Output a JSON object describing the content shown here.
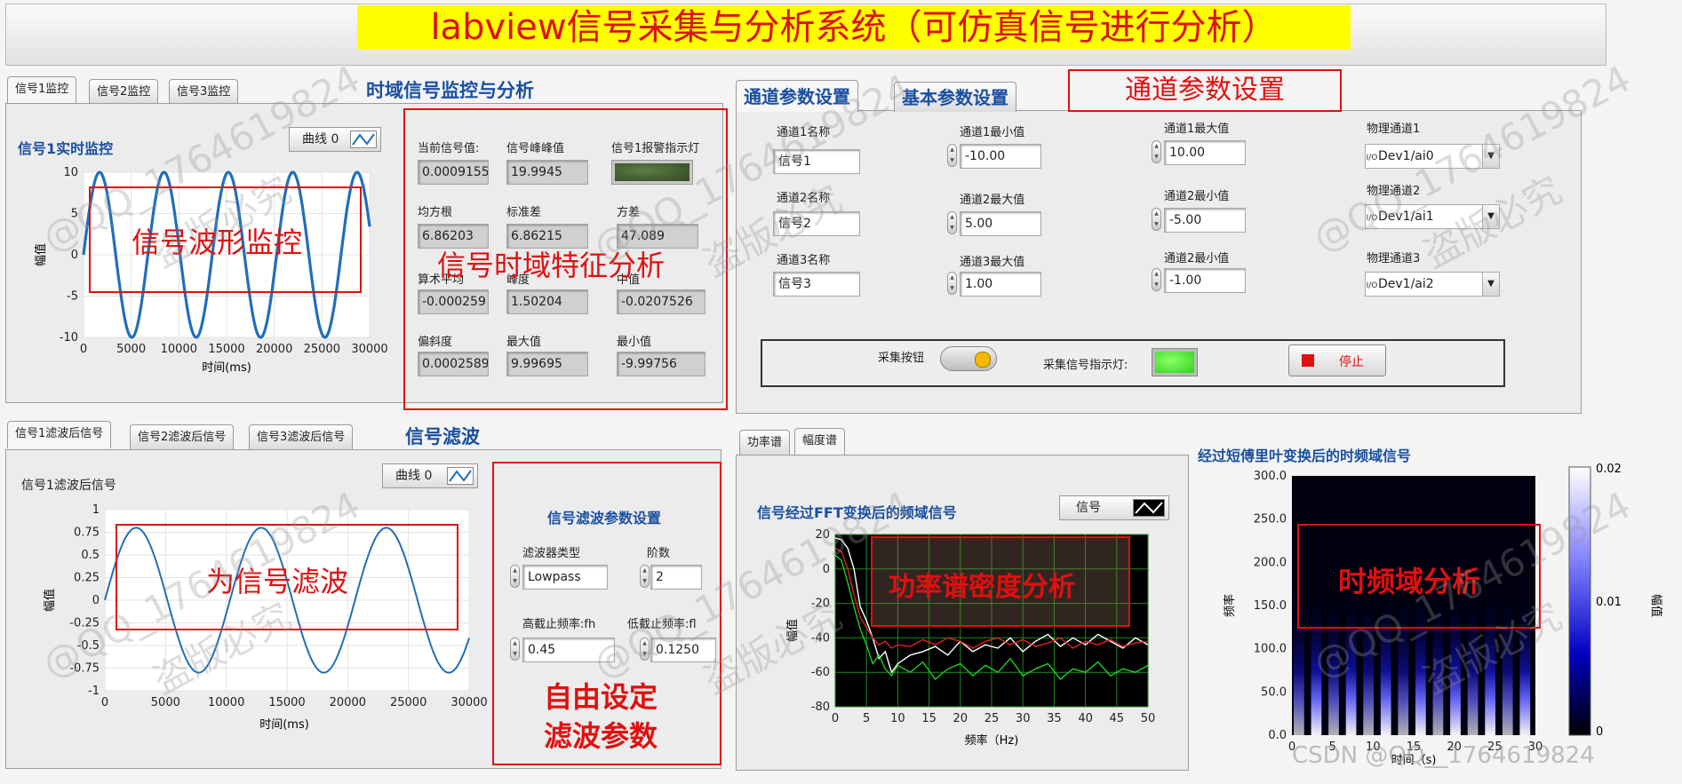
{
  "title": "labview信号采集与分析系统（可仿真信号进行分析）",
  "time_domain": {
    "tabs": [
      "信号1监控",
      "信号2监控",
      "信号3监控"
    ],
    "section_title": "时域信号监控与分析",
    "chart_title": "信号1实时监控",
    "legend": "曲线 0",
    "overlay": "信号波形监控",
    "xlabel": "时间(ms)",
    "ylabel": "幅值"
  },
  "features": {
    "overlay": "信号时域特征分析",
    "items": [
      {
        "label": "当前信号值:",
        "value": "0.0009155"
      },
      {
        "label": "信号峰峰值",
        "value": "19.9945"
      },
      {
        "label": "信号1报警指示灯",
        "value": ""
      },
      {
        "label": "均方根",
        "value": "6.86203"
      },
      {
        "label": "标准差",
        "value": "6.86215"
      },
      {
        "label": "方差",
        "value": "47.089"
      },
      {
        "label": "算术平均",
        "value": "-0.000259"
      },
      {
        "label": "峰度",
        "value": "1.50204"
      },
      {
        "label": "中值",
        "value": "-0.0207526"
      },
      {
        "label": "偏斜度",
        "value": "0.0002589"
      },
      {
        "label": "最大值",
        "value": "9.99695"
      },
      {
        "label": "最小值",
        "value": "-9.99756"
      }
    ]
  },
  "channel": {
    "tabs": [
      "通道参数设置",
      "基本参数设置"
    ],
    "banner": "通道参数设置",
    "fields": [
      {
        "label": "通道1名称",
        "value": "信号1"
      },
      {
        "label": "通道1最小值",
        "value": "-10.00"
      },
      {
        "label": "通道1最大值",
        "value": "10.00"
      },
      {
        "label": "物理通道1",
        "value": "Dev1/ai0"
      },
      {
        "label": "通道2名称",
        "value": "信号2"
      },
      {
        "label": "通道2最大值",
        "value": "5.00"
      },
      {
        "label": "通道2最小值",
        "value": "-5.00"
      },
      {
        "label": "物理通道2",
        "value": "Dev1/ai1"
      },
      {
        "label": "通道3名称",
        "value": "信号3"
      },
      {
        "label": "通道3最大值",
        "value": "1.00"
      },
      {
        "label": "通道2最小值",
        "value": "-1.00"
      },
      {
        "label": "物理通道3",
        "value": "Dev1/ai2"
      }
    ],
    "io_prefix": "I/O",
    "acquire_label": "采集按钮",
    "indicator_label": "采集信号指示灯:",
    "stop_label": "停止"
  },
  "filter": {
    "tabs": [
      "信号1滤波后信号",
      "信号2滤波后信号",
      "信号3滤波后信号"
    ],
    "section_title": "信号滤波",
    "chart_title": "信号1滤波后信号",
    "legend": "曲线 0",
    "overlay": "为信号滤波",
    "xlabel": "时间(ms)",
    "ylabel": "幅值",
    "params_title": "信号滤波参数设置",
    "filter_type_label": "滤波器类型",
    "filter_type_value": "Lowpass",
    "order_label": "阶数",
    "order_value": "2",
    "high_cut_label": "高截止频率:fh",
    "high_cut_value": "0.45",
    "low_cut_label": "低截止频率:fl",
    "low_cut_value": "0.1250",
    "free_note_1": "自由设定",
    "free_note_2": "滤波参数"
  },
  "spectrum": {
    "tabs": [
      "功率谱",
      "幅度谱"
    ],
    "chart_title": "信号经过FFT变换后的频域信号",
    "legend": "信号",
    "overlay": "功率谱密度分析",
    "xlabel": "频率（Hz)",
    "ylabel": "幅值"
  },
  "stft": {
    "title": "经过短傅里叶变换后的时频域信号",
    "overlay": "时频域分析",
    "xlabel": "时间（s)",
    "ylabel": "频率",
    "colorbar_label": "幅值",
    "colorbar_ticks": [
      "0.02",
      "0.01",
      "0"
    ]
  },
  "watermark": "@QQ_1764619824",
  "watermark2": "盗版必究",
  "footer": "CSDN @QQ__1764619824",
  "colors": {
    "accent": "#1a4fa0",
    "red": "#e01010",
    "title_bg": "#ffff00",
    "wave": "#1f6fb8",
    "led_on": "#39e21d",
    "led_off": "#2f4a22"
  },
  "chart_data": [
    {
      "type": "line",
      "title": "信号1实时监控",
      "x_range": [
        0,
        30000
      ],
      "xlim": [
        0,
        30000
      ],
      "ylim": [
        -10,
        10
      ],
      "xticks": [
        "0",
        "5000",
        "10000",
        "15000",
        "20000",
        "25000",
        "30000"
      ],
      "yticks": [
        "10",
        "5",
        "0",
        "-5",
        "-10"
      ],
      "series": [
        {
          "amplitude": 10,
          "period": 6750,
          "phase_deg": 0
        }
      ],
      "xlabel": "时间(ms)",
      "ylabel": "幅值"
    },
    {
      "type": "line",
      "title": "信号1滤波后信号",
      "x_range": [
        0,
        30000
      ],
      "xlim": [
        0,
        30000
      ],
      "ylim": [
        -1,
        1
      ],
      "xticks": [
        "0",
        "5000",
        "10000",
        "15000",
        "20000",
        "25000",
        "30000"
      ],
      "yticks": [
        "1",
        "0.75",
        "0.5",
        "0.25",
        "0",
        "-0.25",
        "-0.5",
        "-0.75",
        "-1"
      ],
      "series": [
        {
          "amplitude": 0.8,
          "period": 10300,
          "phase_deg": 0
        }
      ],
      "xlabel": "时间(ms)",
      "ylabel": "幅值"
    },
    {
      "type": "line",
      "title": "信号经过FFT变换后的频域信号",
      "xlim": [
        0,
        50
      ],
      "ylim": [
        -80,
        20
      ],
      "xticks": [
        "0",
        "5",
        "10",
        "15",
        "20",
        "25",
        "30",
        "35",
        "40",
        "45",
        "50"
      ],
      "yticks": [
        "20",
        "0",
        "-20",
        "-40",
        "-60",
        "-80"
      ],
      "x": [
        0,
        1,
        2,
        3,
        4,
        5,
        6,
        7,
        8,
        9,
        10,
        12,
        14,
        16,
        18,
        20,
        22,
        24,
        26,
        28,
        30,
        32,
        34,
        36,
        38,
        40,
        42,
        44,
        46,
        48,
        50
      ],
      "series": [
        {
          "color": "#ffffff",
          "values": [
            18,
            17,
            12,
            0,
            -22,
            -30,
            -40,
            -52,
            -48,
            -60,
            -55,
            -50,
            -48,
            -45,
            -50,
            -42,
            -48,
            -44,
            -46,
            -40,
            -48,
            -42,
            -38,
            -45,
            -40,
            -44,
            -38,
            -42,
            -46,
            -40,
            -44
          ]
        },
        {
          "color": "#e02020",
          "values": [
            12,
            10,
            0,
            -15,
            -28,
            -34,
            -40,
            -44,
            -42,
            -46,
            -44,
            -45,
            -41,
            -44,
            -40,
            -42,
            -46,
            -42,
            -40,
            -44,
            -41,
            -45,
            -43,
            -40,
            -46,
            -42,
            -44,
            -41,
            -45,
            -43,
            -42
          ]
        },
        {
          "color": "#20d020",
          "values": [
            8,
            5,
            -8,
            -22,
            -35,
            -44,
            -55,
            -50,
            -58,
            -62,
            -56,
            -60,
            -54,
            -64,
            -58,
            -55,
            -62,
            -56,
            -60,
            -52,
            -62,
            -58,
            -55,
            -64,
            -58,
            -60,
            -54,
            -62,
            -58,
            -60,
            -56
          ]
        }
      ],
      "xlabel": "频率（Hz)",
      "ylabel": "幅值"
    },
    {
      "type": "heatmap",
      "title": "经过短傅里叶变换后的时频域信号",
      "xlim": [
        0,
        30
      ],
      "ylim": [
        0,
        300
      ],
      "xticks": [
        "0",
        "5",
        "10",
        "15",
        "20",
        "25",
        "30"
      ],
      "yticks": [
        "300.0",
        "250.0",
        "200.0",
        "150.0",
        "100.0",
        "50.0",
        "0.0"
      ],
      "colorbar_range": [
        0,
        0.02
      ],
      "xlabel": "时间（s)",
      "ylabel": "频率"
    }
  ]
}
